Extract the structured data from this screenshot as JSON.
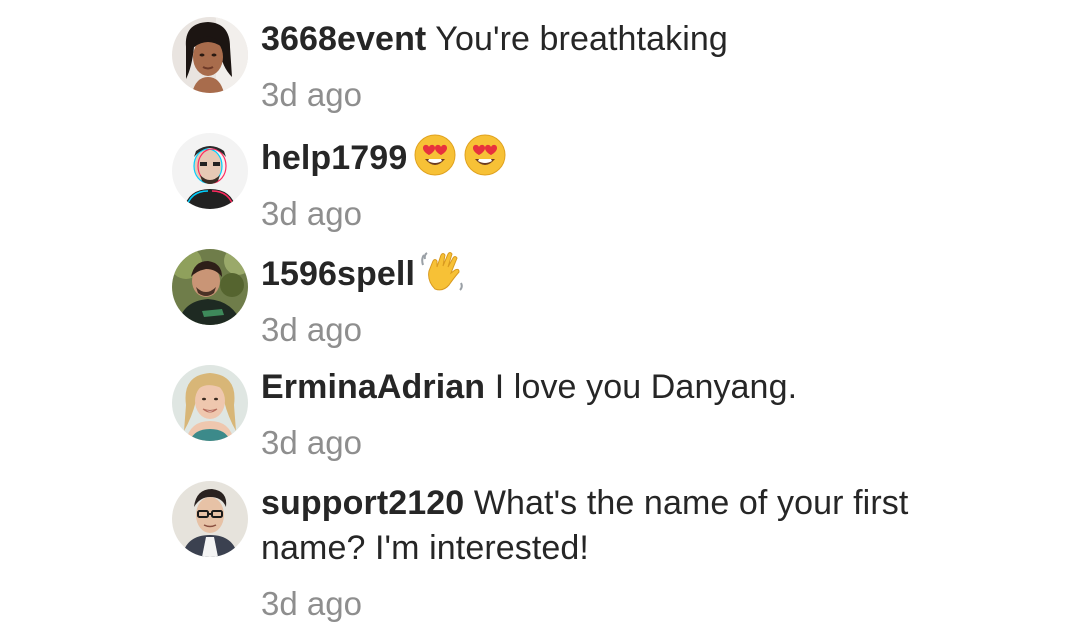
{
  "comments": [
    {
      "username": "3668event",
      "text": "You're breathtaking",
      "time": "3d ago",
      "avatar_icon": "woman-dark-hair-avatar"
    },
    {
      "username": "help1799",
      "text": "",
      "emojis": [
        "heart-eyes-emoji",
        "heart-eyes-emoji"
      ],
      "time": "3d ago",
      "avatar_icon": "glitch-man-avatar"
    },
    {
      "username": "1596spell",
      "text": "",
      "emojis": [
        "waving-hand-emoji"
      ],
      "time": "3d ago",
      "avatar_icon": "man-green-shirt-avatar"
    },
    {
      "username": "ErminaAdrian",
      "text": "I love you Danyang.",
      "time": "3d ago",
      "avatar_icon": "blonde-woman-avatar"
    },
    {
      "username": "support2120",
      "text": "What's the name of your first name? I'm interested!",
      "time": "3d ago",
      "avatar_icon": "man-glasses-avatar"
    }
  ],
  "colors": {
    "text": "#262626",
    "secondary": "#8e8e8e",
    "background": "#ffffff"
  }
}
